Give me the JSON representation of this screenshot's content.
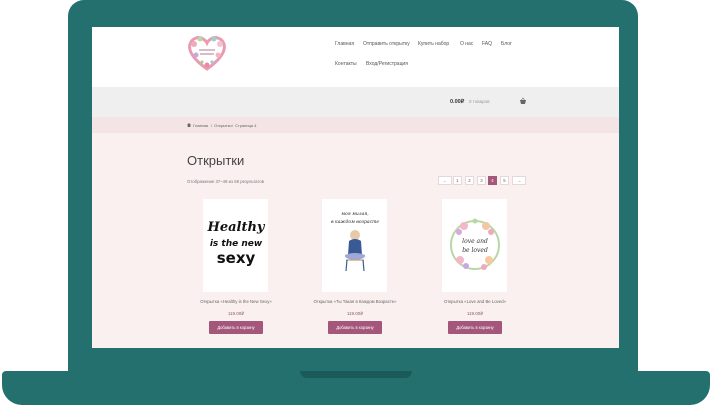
{
  "nav": {
    "items": [
      "Главная",
      "Отправить открытку",
      "Купить набор",
      "О нас",
      "FAQ",
      "Блог",
      "Контакты",
      "Вход/Регистрация"
    ]
  },
  "cart": {
    "total": "0.00₽",
    "count": "0 товаров"
  },
  "breadcrumb": {
    "home": "Главная",
    "sep1": "/",
    "cat": "Открытки",
    "sep2": "/",
    "page": "Страница 4"
  },
  "page": {
    "title": "Открытки",
    "result_count": "Отображение 37–48 из 68 результатов"
  },
  "pagination": [
    "←",
    "1",
    "2",
    "3",
    "4",
    "5",
    "→"
  ],
  "pagination_active": "4",
  "products": [
    {
      "name": "Открытка «Healthy is the New Sexy»",
      "price": "119.00₽",
      "button": "Добавить в корзину",
      "art": [
        "Healthy",
        "is the new",
        "sexy"
      ]
    },
    {
      "name": "Открытка «Ты Такая в Каждом Возрасте»",
      "price": "119.00₽",
      "button": "Добавить в корзину",
      "art": [
        "моя милая,",
        "в каждом возрасте"
      ]
    },
    {
      "name": "Открытка «Love and Be Loved»",
      "price": "119.00₽",
      "button": "Добавить в корзину",
      "art": [
        "love and",
        "be loved"
      ]
    }
  ],
  "colors": {
    "frame": "#23706f",
    "accent": "#a4577b",
    "bg": "#fbf0f0"
  }
}
